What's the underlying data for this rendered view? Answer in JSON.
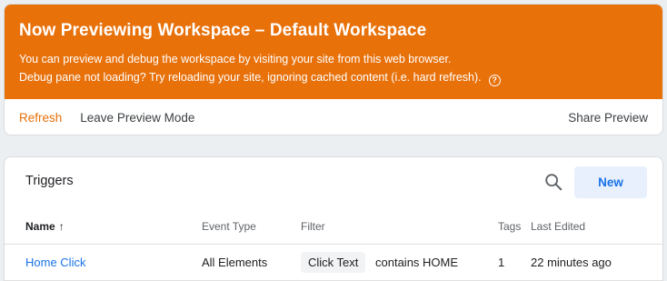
{
  "preview": {
    "title": "Now Previewing Workspace – Default Workspace",
    "line1": "You can preview and debug the workspace by visiting your site from this web browser.",
    "line2": "Debug pane not loading? Try reloading your site, ignoring cached content (i.e. hard refresh).",
    "help_glyph": "?",
    "actions": {
      "refresh": "Refresh",
      "leave": "Leave Preview Mode",
      "share": "Share Preview"
    },
    "accent_color": "#e8710a"
  },
  "triggers": {
    "title": "Triggers",
    "new_label": "New",
    "columns": {
      "name": "Name",
      "sort_arrow": "↑",
      "event_type": "Event Type",
      "filter": "Filter",
      "tags": "Tags",
      "last_edited": "Last Edited"
    },
    "rows": [
      {
        "name": "Home Click",
        "event_type": "All Elements",
        "filter_variable": "Click Text",
        "filter_condition": "contains HOME",
        "tags": "1",
        "last_edited": "22 minutes ago"
      }
    ],
    "link_color": "#1a73e8"
  }
}
